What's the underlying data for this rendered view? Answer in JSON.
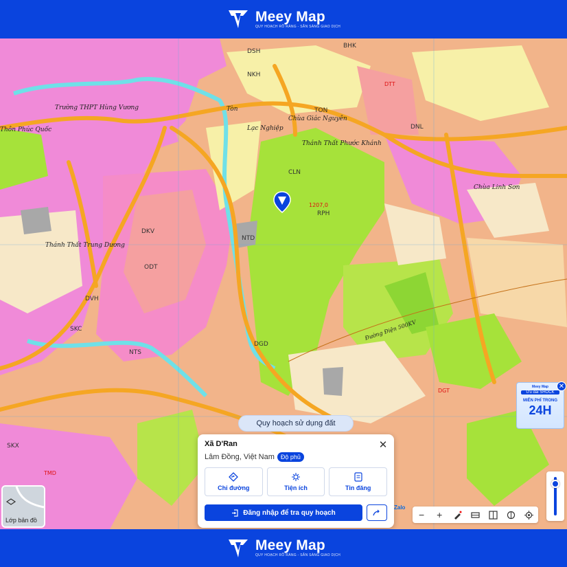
{
  "brand": {
    "name": "Meey Map",
    "tagline": "QUY HOẠCH RÕ RÀNG - SẴN SÀNG GIAO DỊCH"
  },
  "map": {
    "labels": [
      {
        "t": "DSH",
        "c": "black"
      },
      {
        "t": "BHK",
        "c": "black"
      },
      {
        "t": "NKH",
        "c": "black"
      },
      {
        "t": "CLN",
        "c": "black"
      },
      {
        "t": "NTD",
        "c": "black"
      },
      {
        "t": "ODT",
        "c": "black"
      },
      {
        "t": "DKV",
        "c": "black"
      },
      {
        "t": "TON",
        "c": "black"
      },
      {
        "t": "RPH",
        "c": "black"
      },
      {
        "t": "NTS",
        "c": "black"
      },
      {
        "t": "SKX",
        "c": "black"
      },
      {
        "t": "TMD",
        "c": "red"
      },
      {
        "t": "DGD",
        "c": "black"
      },
      {
        "t": "DVH",
        "c": "black"
      },
      {
        "t": "SKC",
        "c": "black"
      },
      {
        "t": "DTT",
        "c": "red"
      },
      {
        "t": "DNL",
        "c": "black"
      },
      {
        "t": "DGT",
        "c": "red"
      },
      {
        "t": "1207,0",
        "c": "red"
      }
    ],
    "place_names": [
      "Trường THPT Hùng Vương",
      "Thánh Thất Phước Khánh",
      "Chùa Giác Nguyên",
      "Thánh Thất Trung Dương",
      "Đường Điện 500KV",
      "Lạc Nghiệp",
      "Tòn",
      "Thôn Phúc Quốc",
      "Chùa Linh Sơn"
    ]
  },
  "chip": {
    "label": "Quy hoạch sử dụng đất"
  },
  "card": {
    "title": "Xã D'Ran",
    "location": "Lâm Đồng, Việt Nam",
    "badge": "Độ phủ",
    "actions": [
      {
        "label": "Chỉ đường",
        "icon": "directions-icon"
      },
      {
        "label": "Tiện ích",
        "icon": "utility-icon"
      },
      {
        "label": "Tin đăng",
        "icon": "listing-icon"
      }
    ],
    "login_label": "Đăng nhập để tra quy hoạch"
  },
  "layer_toggle": {
    "label": "Lớp bản đồ"
  },
  "zalo_label": "Zalo",
  "promo": {
    "brand": "Meey Map",
    "tag": "Ưu đãi SHOCK",
    "line1": "MIỄN PHÍ TRONG",
    "line2": "24H"
  },
  "colors": {
    "accent": "#0a44de"
  }
}
